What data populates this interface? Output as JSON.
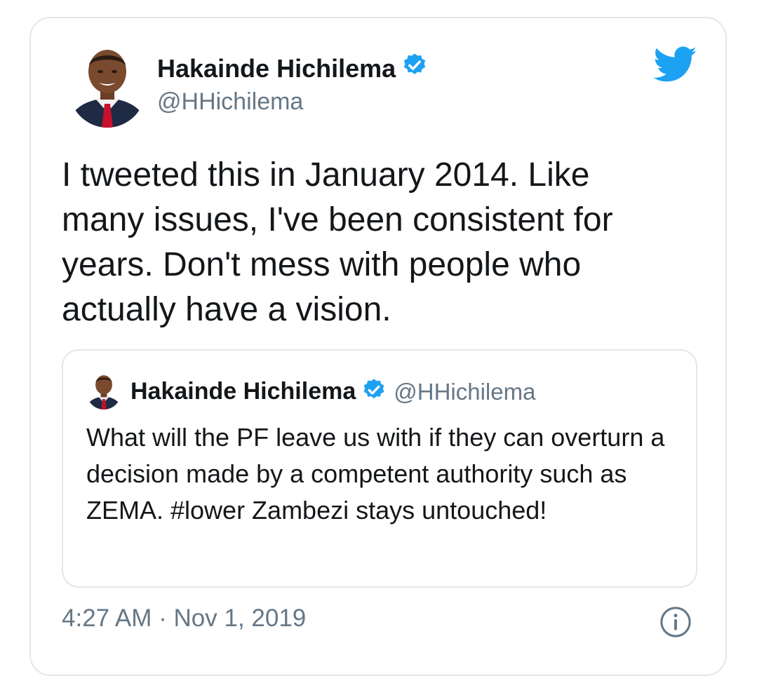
{
  "tweet": {
    "author_name": "Hakainde Hichilema",
    "author_handle": "@HHichilema",
    "text": "I tweeted this in January 2014. Like many issues, I've been consistent for years. Don't mess with people who actually have a vision.",
    "timestamp": "4:27 AM · Nov 1, 2019"
  },
  "quoted_tweet": {
    "author_name": "Hakainde Hichilema",
    "author_handle": "@HHichilema",
    "text": "What will the PF leave us with if they can overturn a decision made by a competent authority such as ZEMA. #lower Zambezi stays untouched!"
  },
  "icons": {
    "verified": "verified-badge-icon",
    "bird": "twitter-bird-icon",
    "info": "info-icon"
  },
  "colors": {
    "twitter_blue": "#1da1f2",
    "text_primary": "#14171a",
    "text_secondary": "#657786",
    "border": "#e1e8ed"
  }
}
